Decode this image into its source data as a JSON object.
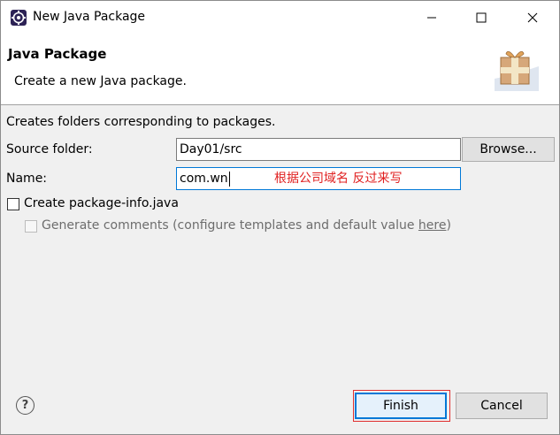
{
  "window": {
    "title": "New Java Package",
    "controls": {
      "minimize": "—",
      "maximize": "☐",
      "close": "✕"
    }
  },
  "header": {
    "title": "Java Package",
    "description": "Create a new Java package."
  },
  "form": {
    "info": "Creates folders corresponding to packages.",
    "source_folder_label": "Source folder:",
    "source_folder_value": "Day01/src",
    "browse_label": "Browse...",
    "name_label": "Name:",
    "name_value": "com.wn",
    "annotation": "根据公司域名 反过来写",
    "create_package_info_label": "Create package-info.java",
    "create_package_info_checked": false,
    "generate_comments_label": "Generate comments (configure templates and default value ",
    "generate_comments_link": "here",
    "generate_comments_suffix": ")",
    "generate_comments_checked": false
  },
  "footer": {
    "help_symbol": "?",
    "finish_label": "Finish",
    "cancel_label": "Cancel"
  },
  "colors": {
    "annotation": "#e02020",
    "focus": "#0078d7",
    "highlight_outline": "#e03030"
  },
  "icons": [
    "eclipse-app-icon",
    "package-wizard-icon",
    "help-icon"
  ]
}
